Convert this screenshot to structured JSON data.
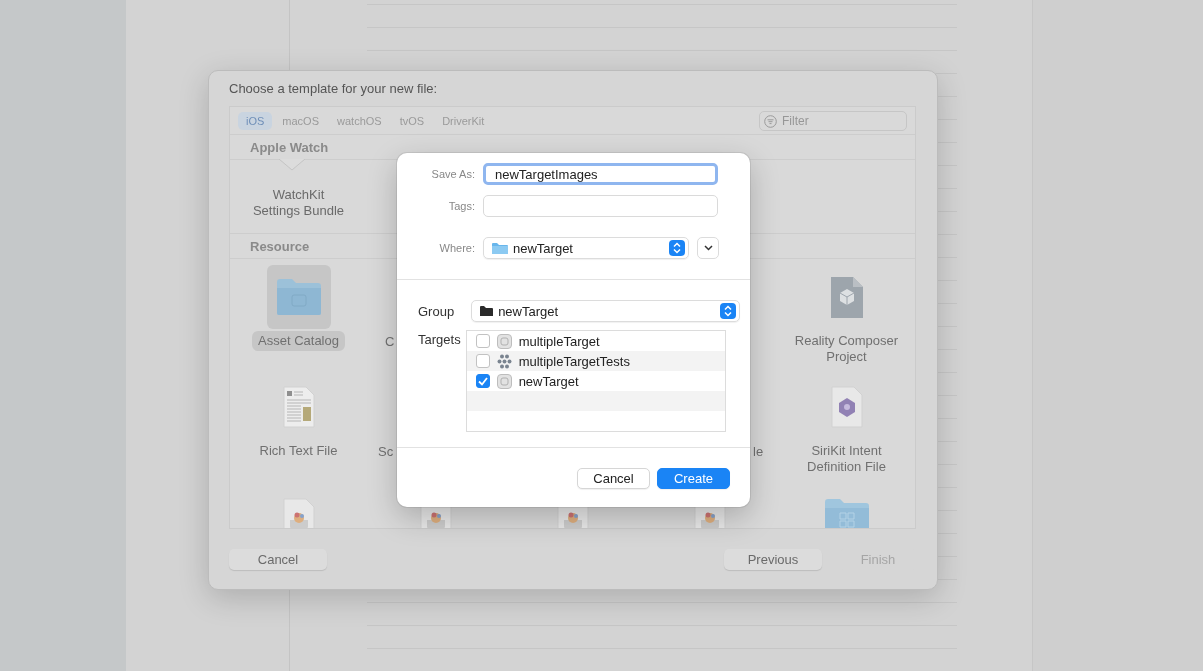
{
  "template_window": {
    "title": "Choose a template for your new file:",
    "tabs": [
      {
        "label": "iOS",
        "selected": true
      },
      {
        "label": "macOS",
        "selected": false
      },
      {
        "label": "watchOS",
        "selected": false
      },
      {
        "label": "tvOS",
        "selected": false
      },
      {
        "label": "DriverKit",
        "selected": false
      }
    ],
    "filter": {
      "placeholder": "Filter"
    },
    "sections": [
      {
        "title": "Apple Watch",
        "rows": [
          [
            {
              "kind": "plain",
              "label": "WatchKit\nSettings Bundle",
              "selected": false
            }
          ]
        ]
      },
      {
        "title": "Resource",
        "rows": [
          [
            {
              "kind": "folder",
              "label": "Asset Catalog",
              "selected": true
            },
            {
              "kind": "peek_start",
              "label": "C"
            },
            {
              "kind": "covered"
            },
            {
              "kind": "covered"
            },
            {
              "kind": "reality",
              "label": "Reality Composer\nProject",
              "selected": false
            }
          ],
          [
            {
              "kind": "rich_text",
              "label": "Rich Text File",
              "selected": false
            },
            {
              "kind": "peek_start",
              "label": "Sc"
            },
            {
              "kind": "covered"
            },
            {
              "kind": "peek_end",
              "label": "le"
            },
            {
              "kind": "siri",
              "label": "SiriKit Intent\nDefinition File",
              "selected": false
            }
          ],
          [
            {
              "kind": "game",
              "selected": false
            },
            {
              "kind": "game",
              "selected": false
            },
            {
              "kind": "game",
              "selected": false
            },
            {
              "kind": "game",
              "selected": false
            },
            {
              "kind": "folder_grid",
              "selected": false
            }
          ]
        ]
      }
    ],
    "buttons": [
      {
        "label": "Cancel",
        "disabled": false
      },
      {
        "label": "Previous",
        "disabled": false
      },
      {
        "label": "Finish",
        "disabled": true
      }
    ]
  },
  "save_sheet": {
    "save_as": {
      "label": "Save As:",
      "value": "newTargetImages"
    },
    "tags": {
      "label": "Tags:"
    },
    "where": {
      "label": "Where:",
      "value": "newTarget"
    },
    "group": {
      "label": "Group",
      "value": "newTarget"
    },
    "targets": {
      "label": "Targets",
      "items": [
        {
          "name": "multipleTarget",
          "checked": false,
          "kind": "app"
        },
        {
          "name": "multipleTargetTests",
          "checked": false,
          "kind": "tests"
        },
        {
          "name": "newTarget",
          "checked": true,
          "kind": "app"
        }
      ]
    },
    "buttons": [
      {
        "label": "Cancel",
        "default": false
      },
      {
        "label": "Create",
        "default": true
      }
    ]
  }
}
